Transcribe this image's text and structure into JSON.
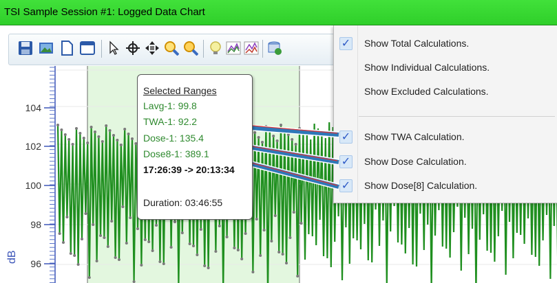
{
  "window": {
    "title": "TSI Sample Session #1: Logged Data Chart"
  },
  "toolbar": {
    "buttons": [
      "save-icon",
      "image-icon",
      "new-page-icon",
      "window-icon",
      "pointer-icon",
      "crosshair-icon",
      "pan-icon",
      "zoom-in-icon",
      "zoom-out-icon",
      "lightbulb-icon",
      "line-chart-icon",
      "line-chart-alt-icon",
      "database-add-icon"
    ]
  },
  "chart": {
    "y_axis_label": "dB",
    "y_ticks": [
      "104",
      "102",
      "100",
      "98",
      "96"
    ],
    "colors": {
      "series": "#1f8f1f",
      "selection": "#e3f7df",
      "points": "#7a7a7a"
    }
  },
  "tooltip": {
    "heading": "Selected Ranges",
    "lavg": "Lavg-1: 99.8",
    "twa": "TWA-1: 92.2",
    "dose": "Dose-1: 135.4",
    "dose8": "Dose8-1: 389.1",
    "range": "17:26:39 -> 20:13:34",
    "duration": "Duration: 03:46:55"
  },
  "menu": {
    "items": [
      {
        "label": "Show Total Calculations.",
        "checked": true
      },
      {
        "label": "Show Individual Calculations.",
        "checked": false
      },
      {
        "label": "Show Excluded Calculations.",
        "checked": false
      },
      {
        "label": "Show TWA Calculation.",
        "checked": true
      },
      {
        "label": "Show Dose Calculation.",
        "checked": true
      },
      {
        "label": "Show Dose[8] Calculation.",
        "checked": true
      }
    ],
    "check_glyph": "✓"
  }
}
